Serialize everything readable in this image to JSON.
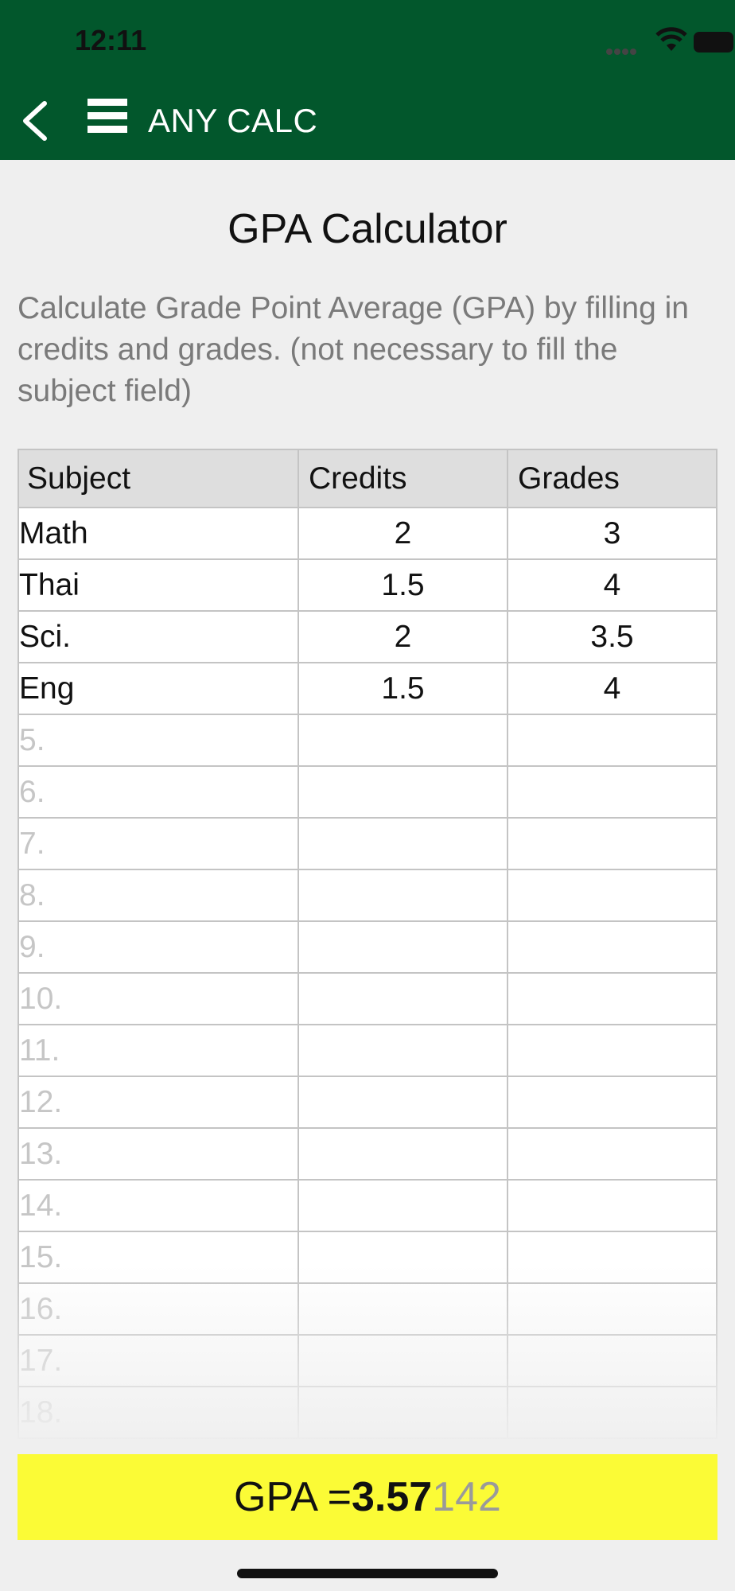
{
  "status_bar": {
    "time": "12:11"
  },
  "nav": {
    "app_title": "ANY CALC"
  },
  "page": {
    "title": "GPA Calculator",
    "description": "Calculate Grade Point Average (GPA) by filling in credits and grades. (not necessary to fill the subject field)"
  },
  "table": {
    "headers": {
      "subject": "Subject",
      "credits": "Credits",
      "grades": "Grades"
    },
    "rows": [
      {
        "subject": "Math",
        "credits": "2",
        "grades": "3"
      },
      {
        "subject": "Thai",
        "credits": "1.5",
        "grades": "4"
      },
      {
        "subject": "Sci.",
        "credits": "2",
        "grades": "3.5"
      },
      {
        "subject": "Eng",
        "credits": "1.5",
        "grades": "4"
      }
    ],
    "placeholders": [
      "5.",
      "6.",
      "7.",
      "8.",
      "9.",
      "10.",
      "11.",
      "12.",
      "13.",
      "14.",
      "15.",
      "16.",
      "17.",
      "18."
    ]
  },
  "result": {
    "label": "GPA = ",
    "value_main": "3.57",
    "value_rest": "142"
  },
  "colors": {
    "nav_bg": "#02572c",
    "result_bg": "#fbfb36"
  },
  "icons": {
    "back": "chevron-left-icon",
    "menu": "hamburger-menu-icon"
  }
}
